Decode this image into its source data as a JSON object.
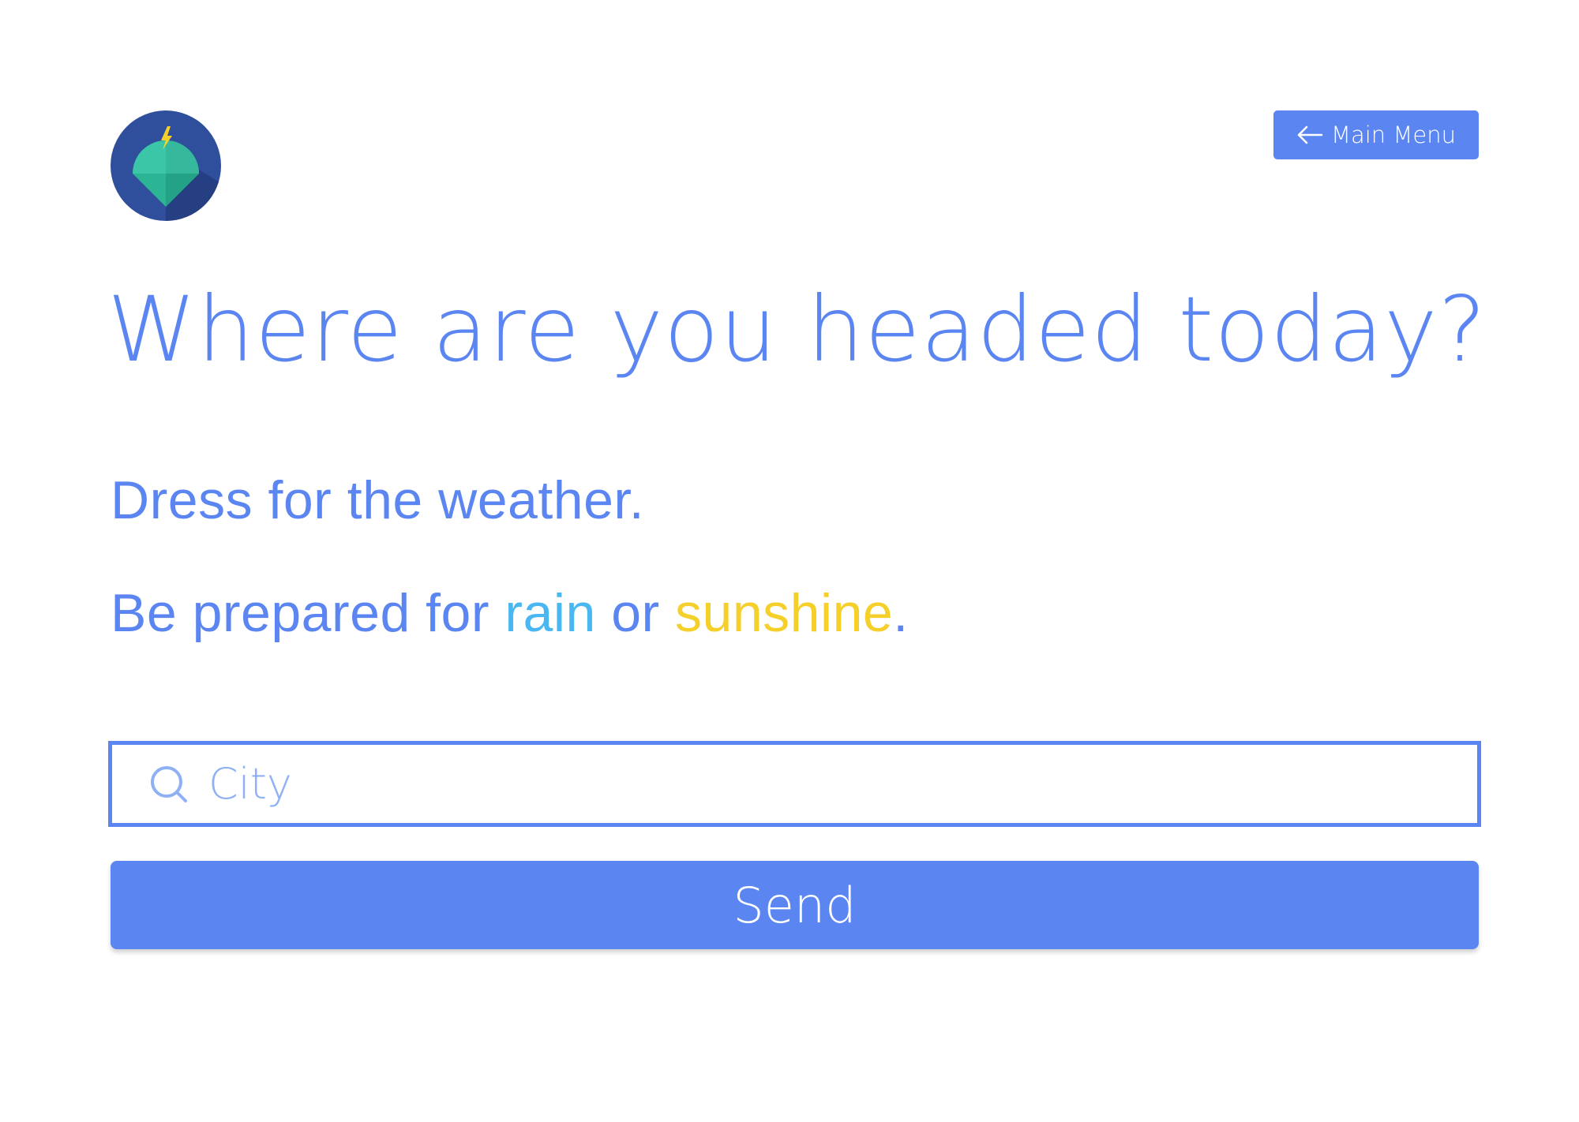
{
  "logo": {
    "icon": "umbrella-lightning-icon",
    "colors": {
      "background": "#2f4f9c",
      "shadow": "#263f82",
      "umbrella": "#3cc6a8",
      "umbrella_dark": "#29a98b",
      "bolt": "#f5cf2a"
    }
  },
  "header": {
    "menu_button_label": "Main Menu",
    "menu_button_icon": "arrow-left-icon"
  },
  "main": {
    "title": "Where are you headed today?",
    "tagline_1": "Dress for the weather.",
    "tagline_2": {
      "prefix": "Be prepared for ",
      "rain": "rain",
      "middle": " or ",
      "sunshine": "sunshine",
      "suffix": "."
    }
  },
  "search": {
    "icon": "search-icon",
    "placeholder": "City",
    "value": ""
  },
  "actions": {
    "send_label": "Send"
  },
  "colors": {
    "accent": "#5b86f2",
    "rain": "#4bb7f0",
    "sunshine": "#f5cf2a",
    "placeholder": "#8fb0f5"
  }
}
